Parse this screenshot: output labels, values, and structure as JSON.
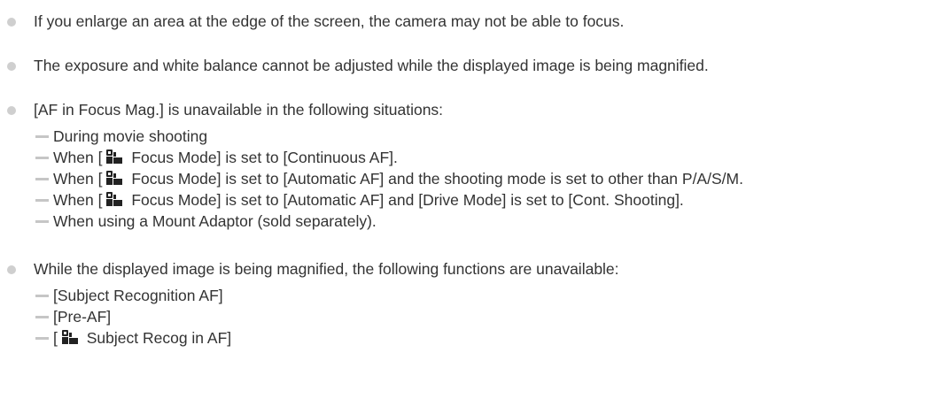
{
  "notes": [
    {
      "text": "If you enlarge an area at the edge of the screen, the camera may not be able to focus."
    },
    {
      "text": "The exposure and white balance cannot be adjusted while the displayed image is being magnified."
    },
    {
      "text": "[AF in Focus Mag.] is unavailable in the following situations:",
      "sub": [
        {
          "pre": "During movie shooting"
        },
        {
          "pre": "When [",
          "icon": "camera-photo-icon",
          "post": " Focus Mode] is set to [Continuous AF]."
        },
        {
          "pre": "When [",
          "icon": "camera-photo-icon",
          "post": " Focus Mode] is set to [Automatic AF] and the shooting mode is set to other than P/A/S/M."
        },
        {
          "pre": "When [",
          "icon": "camera-photo-icon",
          "post": " Focus Mode] is set to [Automatic AF] and [Drive Mode] is set to [Cont. Shooting]."
        },
        {
          "pre": "When using a Mount Adaptor (sold separately)."
        }
      ]
    },
    {
      "text": "While the displayed image is being magnified, the following functions are unavailable:",
      "sub": [
        {
          "pre": "[Subject Recognition AF]"
        },
        {
          "pre": "[Pre-AF]"
        },
        {
          "pre": "[",
          "icon": "camera-photo-icon",
          "post": " Subject Recog in AF]"
        }
      ]
    }
  ],
  "colors": {
    "text": "#333333",
    "bullet": "#cfcfcf",
    "dash": "#c6c6c6",
    "icon": "#222222"
  }
}
